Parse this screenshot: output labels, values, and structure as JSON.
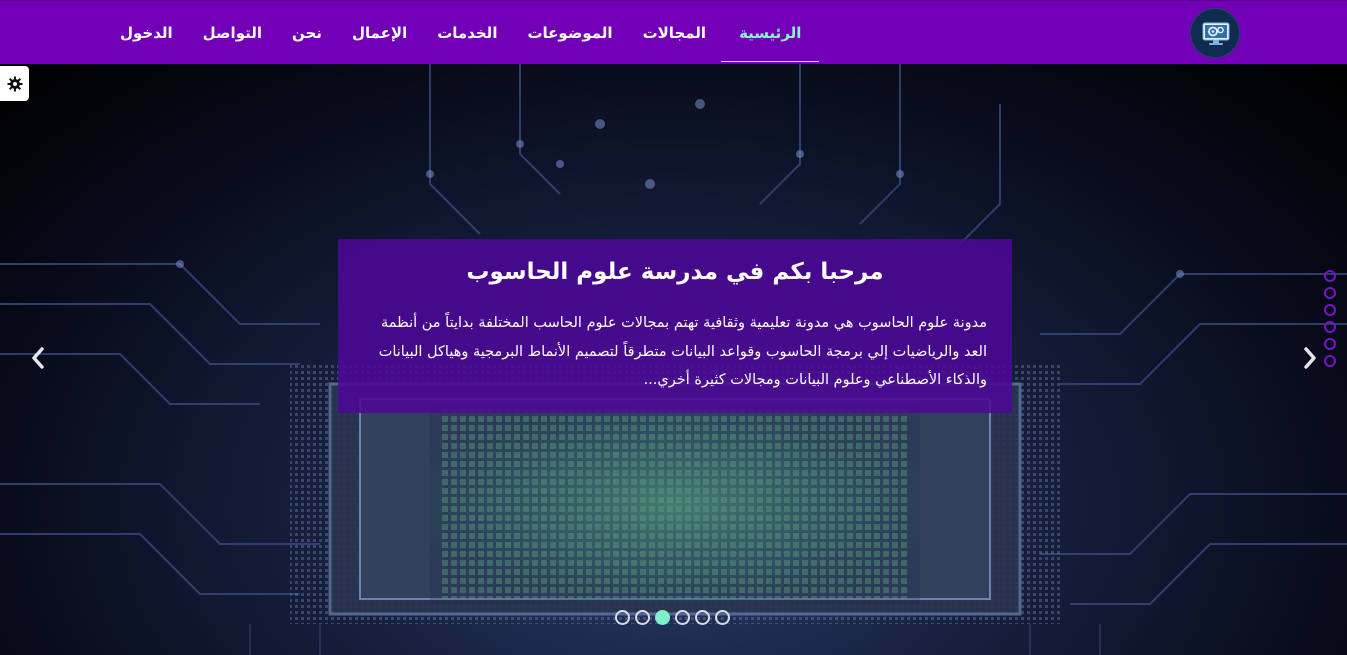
{
  "nav": {
    "items": [
      {
        "label": "الرئيسية",
        "active": true
      },
      {
        "label": "المجالات"
      },
      {
        "label": "الموضوعات"
      },
      {
        "label": "الخدمات"
      },
      {
        "label": "الإعمال"
      },
      {
        "label": "نحن"
      },
      {
        "label": "التواصل"
      },
      {
        "label": "الدخول"
      }
    ]
  },
  "hero": {
    "title": "مرحبا بكم في مدرسة علوم الحاسوب",
    "description": "مدونة علوم الحاسوب هي مدونة تعليمية وثقافية تهتم بمجالات علوم الحاسب المختلفة بدايتاً من أنظمة العد والرياضيات إلي برمجة الحاسوب وقواعد البيانات متطرقاً لتصميم الأنماط البرمجية وهياكل البيانات والذكاء الأصطناعي وعلوم البيانات ومجالات كثيرة أخري...",
    "slide_count": 6,
    "active_slide": 3
  },
  "colors": {
    "navbar": "#7200b6",
    "caption_bg": "#4c0896",
    "active_nav": "#8cf2d2",
    "active_dot": "#7ff0c7",
    "side_dot": "#7a12c9"
  },
  "icons": {
    "logo": "computer-gear-logo",
    "settings": "gear-icon",
    "prev": "chevron-left-icon",
    "next": "chevron-right-icon"
  }
}
